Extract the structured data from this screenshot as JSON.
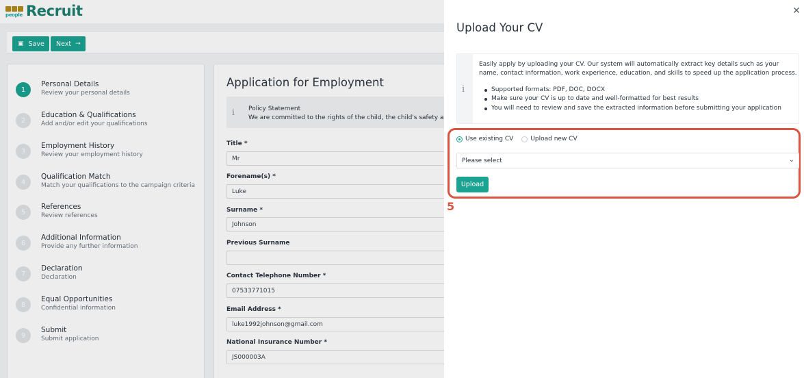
{
  "brand": {
    "logo_word": "people",
    "logo_text": "Recruit"
  },
  "toolbar": {
    "save_label": "Save",
    "next_label": "Next",
    "save_icon": "floppy-disk-icon",
    "next_icon": "arrow-right-icon"
  },
  "steps": [
    {
      "num": "1",
      "title": "Personal Details",
      "subtitle": "Review your personal details"
    },
    {
      "num": "2",
      "title": "Education & Qualifications",
      "subtitle": "Add and/or edit your qualifications"
    },
    {
      "num": "3",
      "title": "Employment History",
      "subtitle": "Review your employment history"
    },
    {
      "num": "4",
      "title": "Qualification Match",
      "subtitle": "Match your qualifications to the campaign criteria"
    },
    {
      "num": "5",
      "title": "References",
      "subtitle": "Review references"
    },
    {
      "num": "6",
      "title": "Additional Information",
      "subtitle": "Provide any further information"
    },
    {
      "num": "7",
      "title": "Declaration",
      "subtitle": "Declaration"
    },
    {
      "num": "8",
      "title": "Equal Opportunities",
      "subtitle": "Confidential information"
    },
    {
      "num": "9",
      "title": "Submit",
      "subtitle": "Submit application"
    }
  ],
  "form": {
    "title": "Application for Employment",
    "policy_title": "Policy Statement",
    "policy_text": "We are committed to the rights of the child, the child's safety an",
    "fields": [
      {
        "label": "Title *",
        "value": "Mr"
      },
      {
        "label": "Forename(s) *",
        "value": "Luke"
      },
      {
        "label": "Surname *",
        "value": "Johnson"
      },
      {
        "label": "Previous Surname",
        "value": ""
      },
      {
        "label": "Contact Telephone Number *",
        "value": "07533771015"
      },
      {
        "label": "Email Address *",
        "value": "luke1992johnson@gmail.com"
      },
      {
        "label": "National Insurance Number *",
        "value": "JS000003A"
      }
    ]
  },
  "drawer": {
    "title": "Upload Your CV",
    "close_icon": "close-icon",
    "info_paragraph": "Easily apply by uploading your CV. Our system will automatically extract key details such as your name, contact information, work experience, education, and skills to speed up the application process.",
    "info_bullets": [
      "Supported formats: PDF, DOC, DOCX",
      "Make sure your CV is up to date and well-formatted for best results",
      "You will need to review and save the extracted information before submitting your application"
    ],
    "radio_existing": "Use existing CV",
    "radio_new": "Upload new CV",
    "select_value": "Please select",
    "upload_label": "Upload"
  },
  "annotation": {
    "marker": "5",
    "color": "#d9533f"
  },
  "colors": {
    "accent": "#1aa391",
    "highlight": "#d9533f"
  }
}
